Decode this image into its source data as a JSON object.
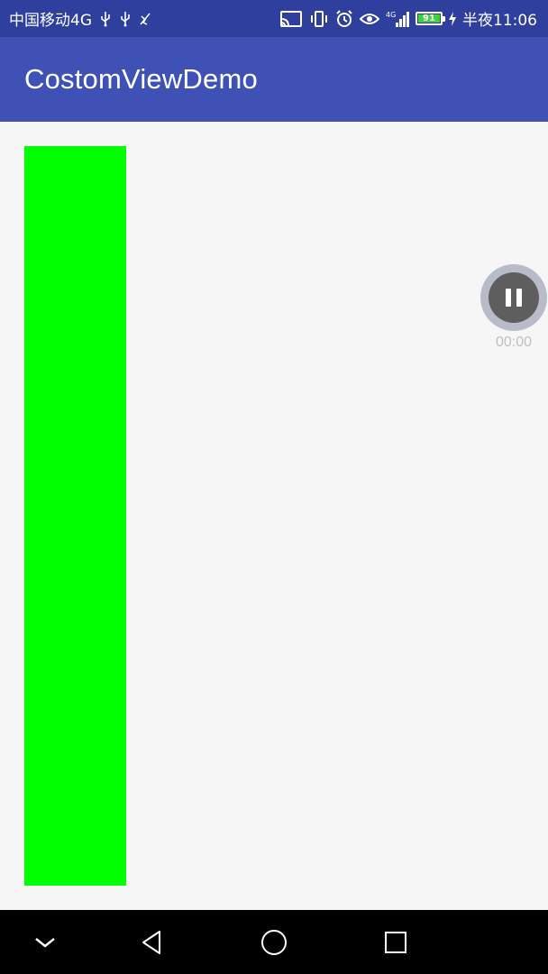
{
  "status_bar": {
    "carrier": "中国移动4G",
    "time": "半夜11:06",
    "battery_level": "91",
    "network_badge": "4G",
    "icons_left": [
      "usb-icon",
      "usb-icon",
      "no-signal-icon"
    ],
    "icons_right": [
      "cast-icon",
      "vibrate-icon",
      "alarm-icon",
      "eye-icon",
      "signal-icon",
      "battery-icon",
      "charging-icon"
    ]
  },
  "app_bar": {
    "title": "CostomViewDemo"
  },
  "content": {
    "bar_color": "#00ff00"
  },
  "floating_recorder": {
    "timer": "00:00",
    "icon": "pause-icon"
  },
  "nav_bar": {
    "buttons": [
      "hide-nav-icon",
      "back-icon",
      "home-icon",
      "recents-icon"
    ]
  },
  "colors": {
    "status_bar": "#2f3f9e",
    "app_bar": "#3f51b5",
    "background": "#f6f6f6",
    "nav_bar": "#000000"
  }
}
